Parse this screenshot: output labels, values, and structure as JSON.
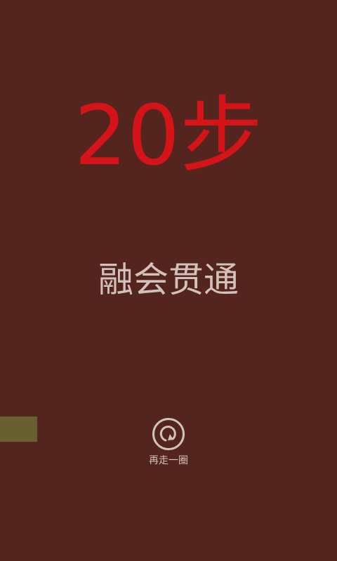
{
  "result": {
    "steps_text": "20步",
    "rank_title": "融会贯通"
  },
  "replay": {
    "label": "再走一圈",
    "icon": "replay-icon"
  },
  "colors": {
    "background": "#54251e",
    "steps": "#d41418",
    "text": "#d2c2bc",
    "side_tab": "#676031"
  }
}
